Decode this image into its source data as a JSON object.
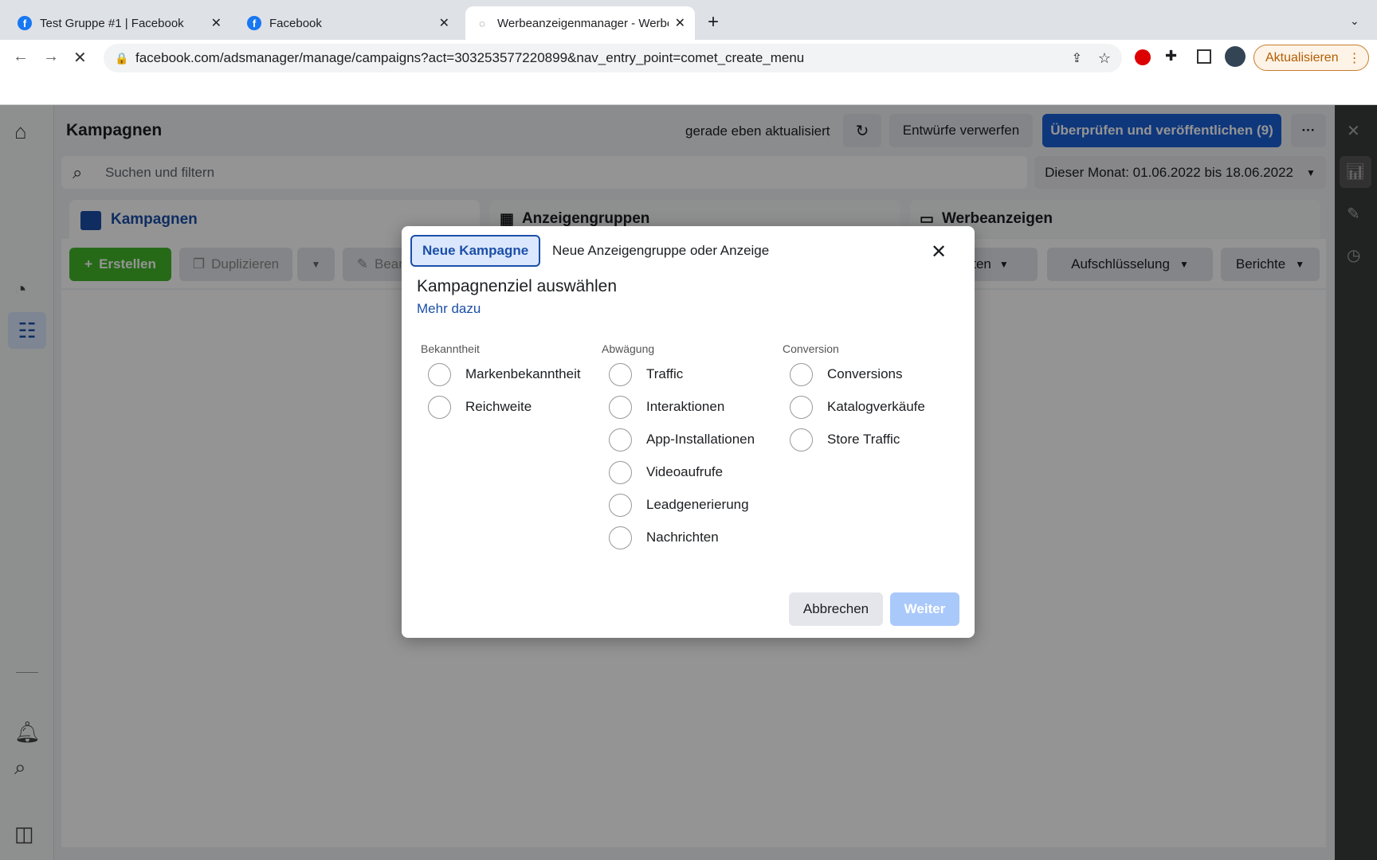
{
  "browser": {
    "tabs": [
      {
        "title": "Test Gruppe #1 | Facebook",
        "icon": "facebook-icon"
      },
      {
        "title": "Facebook",
        "icon": "facebook-icon"
      },
      {
        "title": "Werbeanzeigenmanager - Werbeanzeigenmanager",
        "icon": "loading-icon"
      }
    ],
    "url": "facebook.com/adsmanager/manage/campaigns?act=303253577220899&nav_entry_point=comet_create_menu",
    "update_label": "Aktualisieren"
  },
  "header": {
    "title": "Kampagnen",
    "status": "gerade eben aktualisiert",
    "discard": "Entwürfe verwerfen",
    "publish": "Überprüfen und veröffentlichen (9)",
    "more": "···"
  },
  "search": {
    "placeholder": "Suchen und filtern",
    "date_range": "Dieser Monat: 01.06.2022 bis 18.06.2022"
  },
  "level_tabs": [
    "Kampagnen",
    "Anzeigengruppen",
    "Werbeanzeigen"
  ],
  "toolbar": {
    "create": "Erstellen",
    "duplicate": "Duplizieren",
    "edit": "Bearbeiten",
    "columns": "Spalten",
    "breakdown": "Aufschlüsselung",
    "reports": "Berichte"
  },
  "modal": {
    "tabs": [
      "Neue Kampagne",
      "Neue Anzeigengruppe oder Anzeige"
    ],
    "title": "Kampagnenziel auswählen",
    "learn_more": "Mehr dazu",
    "columns": [
      {
        "heading": "Bekanntheit",
        "options": [
          "Markenbekanntheit",
          "Reichweite"
        ]
      },
      {
        "heading": "Abwägung",
        "options": [
          "Traffic",
          "Interaktionen",
          "App-Installationen",
          "Videoaufrufe",
          "Leadgenerierung",
          "Nachrichten"
        ]
      },
      {
        "heading": "Conversion",
        "options": [
          "Conversions",
          "Katalogverkäufe",
          "Store Traffic"
        ]
      }
    ],
    "cancel": "Abbrechen",
    "next": "Weiter"
  },
  "colors": {
    "accent": "#1b4fa8",
    "create": "#42b72a",
    "publish": "#1b5fd6",
    "next_disabled": "#aac9fb"
  }
}
